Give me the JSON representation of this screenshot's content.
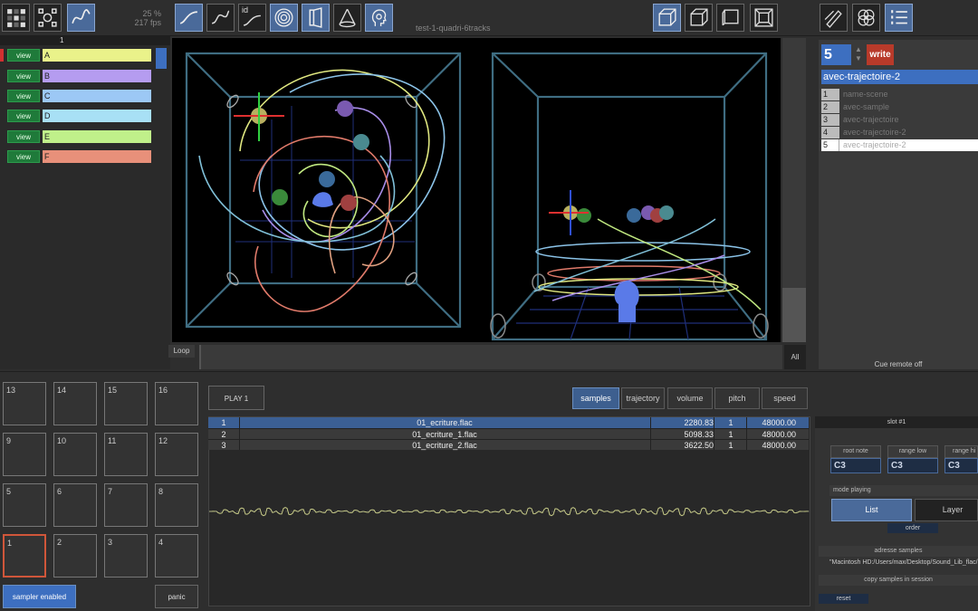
{
  "header": {
    "zoom": "25 %",
    "fps": "217 fps",
    "session_title": "test-1-quadri-6tracks",
    "tool_id_label": "id"
  },
  "tracks": {
    "column_header": "1",
    "view_label": "view",
    "items": [
      {
        "name": "A",
        "color": "#eaf28a"
      },
      {
        "name": "B",
        "color": "#b59cf0"
      },
      {
        "name": "C",
        "color": "#9cc8f5"
      },
      {
        "name": "D",
        "color": "#a8e0f5"
      },
      {
        "name": "E",
        "color": "#c0f08a"
      },
      {
        "name": "F",
        "color": "#e8907a"
      }
    ]
  },
  "viewport": {
    "loop_label": "Loop",
    "all_label": "All"
  },
  "scenes": {
    "current_number": "5",
    "write_label": "write",
    "current_name": "avec-trajectoire-2",
    "list": [
      {
        "n": "1",
        "name": "name-scene"
      },
      {
        "n": "2",
        "name": "avec-sample"
      },
      {
        "n": "3",
        "name": "avec-trajectoire"
      },
      {
        "n": "4",
        "name": "avec-trajectoire-2"
      },
      {
        "n": "5",
        "name": "avec-trajectoire-2"
      }
    ],
    "cue_status": "Cue remote off"
  },
  "pads": {
    "rows": [
      [
        "13",
        "14",
        "15",
        "16"
      ],
      [
        "9",
        "10",
        "11",
        "12"
      ],
      [
        "5",
        "6",
        "7",
        "8"
      ],
      [
        "1",
        "2",
        "3",
        "4"
      ]
    ],
    "sampler_enabled_label": "sampler enabled",
    "panic_label": "panic"
  },
  "sampler": {
    "play_label": "PLAY 1",
    "tabs": [
      "samples",
      "trajectory",
      "volume",
      "pitch",
      "speed"
    ],
    "samples": [
      {
        "idx": "1",
        "file": "01_ecriture.flac",
        "duration": "2280.83",
        "ch": "1",
        "rate": "48000.00"
      },
      {
        "idx": "2",
        "file": "01_ecriture_1.flac",
        "duration": "5098.33",
        "ch": "1",
        "rate": "48000.00"
      },
      {
        "idx": "3",
        "file": "01_ecriture_2.flac",
        "duration": "3622.50",
        "ch": "1",
        "rate": "48000.00"
      }
    ]
  },
  "slot": {
    "title": "slot #1",
    "root_note_label": "root note",
    "root_note": "C3",
    "range_low_label": "range low",
    "range_low": "C3",
    "range_high_label": "range hi",
    "range_high": "C3",
    "mode_playing_label": "mode playing",
    "mode_list": "List",
    "mode_layer": "Layer",
    "order_label": "order",
    "address_label": "adresse samples",
    "address_value": "\"Macintosh HD:/Users/max/Desktop/Sound_Lib_flac/",
    "copy_label": "copy samples in session",
    "reset_label": "reset"
  }
}
